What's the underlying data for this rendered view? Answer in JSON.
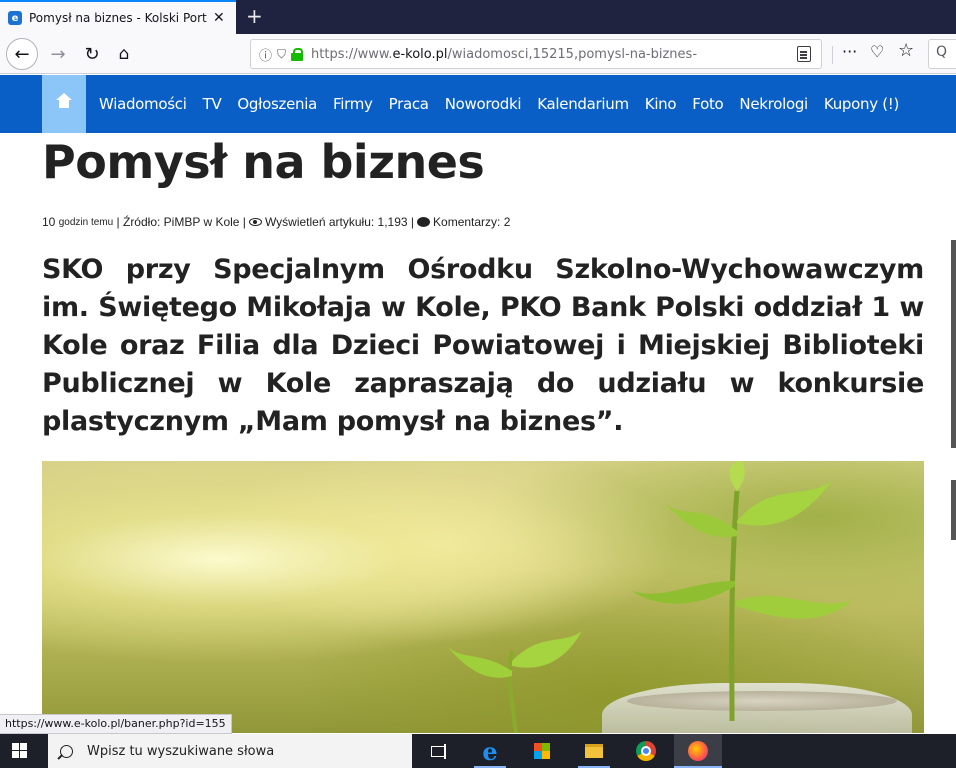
{
  "browser": {
    "tab_title": "Pomysł na biznes - Kolski Portal",
    "tab_favicon": "e",
    "tab_close": "✕",
    "new_tab": "+",
    "back": "←",
    "forward": "→",
    "reload": "↻",
    "home": "⌂",
    "url_prefix": "https://www.",
    "url_domain": "e-kolo.pl",
    "url_path": "/wiadomosci,15215,pomysl-na-biznes-",
    "page_actions": "···",
    "pocket": "♡",
    "bookmark": "☆",
    "search_glyph": "Q"
  },
  "site_nav": {
    "items": [
      "Wiadomości",
      "TV",
      "Ogłoszenia",
      "Firmy",
      "Praca",
      "Noworodki",
      "Kalendarium",
      "Kino",
      "Foto",
      "Nekrologi",
      "Kupony (!)"
    ]
  },
  "article": {
    "title": "Pomysł na biznes",
    "time": "10",
    "time_suffix": "godzin temu",
    "source": "| Źródło: PiMBP w Kole |",
    "views": "Wyświetleń artykułu: 1,193 |",
    "comments": "Komentarzy: 2",
    "lead": "SKO przy Specjalnym Ośrodku Szkolno-Wychowawczym im. Świętego Mikołaja w Kole, PKO Bank Polski oddział 1 w Kole oraz Filia dla Dzieci Powiatowej i Miejskiej Biblioteki Publicznej w Kole zapraszają do udziału w konkursie plastycznym „Mam pomysł na biznes”."
  },
  "status_link": "https://www.e-kolo.pl/baner.php?id=155",
  "taskbar": {
    "search_placeholder": "Wpisz tu wyszukiwane słowa",
    "edge_glyph": "e"
  },
  "colors": {
    "nav_blue": "#0a5fc7",
    "home_tab": "#8cc5f7",
    "taskbar": "#1d2028"
  }
}
